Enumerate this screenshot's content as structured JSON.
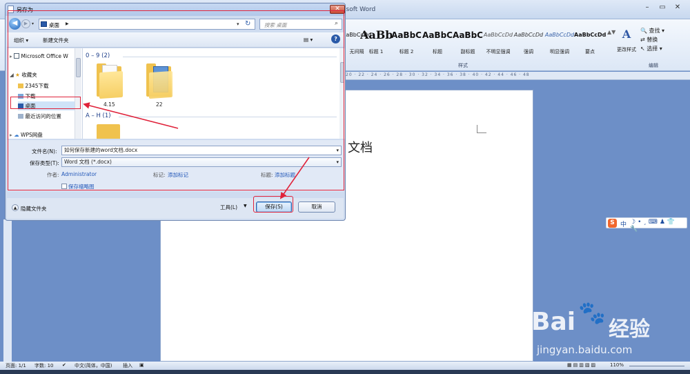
{
  "word": {
    "title_fragment": "osoft Word",
    "styles": [
      {
        "preview": "AaBbCcDd",
        "name": "无间隔"
      },
      {
        "preview": "AaBb",
        "name": "标题 1"
      },
      {
        "preview": "AaBbC",
        "name": "标题 2"
      },
      {
        "preview": "AaBbC",
        "name": "标题"
      },
      {
        "preview": "AaBbC",
        "name": "副标题"
      },
      {
        "preview": "AaBbCcDd",
        "name": "不明显强调"
      },
      {
        "preview": "AaBbCcDd",
        "name": "强调"
      },
      {
        "preview": "AaBbCcDd",
        "name": "明显强调"
      },
      {
        "preview": "AaBbCcDd",
        "name": "要点"
      }
    ],
    "styles_group": "样式",
    "change_styles": "更改样式",
    "editing": {
      "find": "查找",
      "replace": "替换",
      "select": "选择",
      "group": "编辑"
    },
    "ruler_numbers": "20 · 22 · 24 · 26 · 28 · 30 · 32 · 34 · 36 · 38 · 40 · 42 · 44 · 46 · 48",
    "document_text": "文档",
    "status": {
      "page": "页面: 1/1",
      "words": "字数: 10",
      "language": "中文(简体，中国)",
      "insert": "插入",
      "zoom": "110%"
    }
  },
  "ime": {
    "logo": "S",
    "mode": "中"
  },
  "watermark": {
    "brand": "Bai",
    "brand2": "经验",
    "url": "jingyan.baidu.com"
  },
  "dialog": {
    "title": "另存为",
    "address": "桌面",
    "search_placeholder": "搜索 桌面",
    "toolbar": {
      "organize": "组织 ▾",
      "new_folder": "新建文件夹"
    },
    "nav": [
      {
        "label": "Microsoft Office W"
      },
      {
        "label": "收藏夹"
      },
      {
        "label": "2345下载"
      },
      {
        "label": "下载"
      },
      {
        "label": "桌面"
      },
      {
        "label": "最近访问的位置"
      },
      {
        "label": "WPS网盘"
      }
    ],
    "groups": {
      "g1": "0 – 9 (2)",
      "g2": "A – H (1)"
    },
    "files": [
      {
        "name": "4.15"
      },
      {
        "name": "22"
      }
    ],
    "form": {
      "filename_label": "文件名(N):",
      "filename_value": "如何保存新建的word文档.docx",
      "filetype_label": "保存类型(T):",
      "filetype_value": "Word 文档 (*.docx)",
      "author_label": "作者:",
      "author_value": "Administrator",
      "tags_label": "标记:",
      "tags_value": "添加标记",
      "title_label": "标题:",
      "title_value": "添加标题",
      "thumbnail_label": "保存缩略图"
    },
    "hide_folders": "隐藏文件夹",
    "tools": "工具(L)",
    "save": "保存(S)",
    "cancel": "取消"
  }
}
